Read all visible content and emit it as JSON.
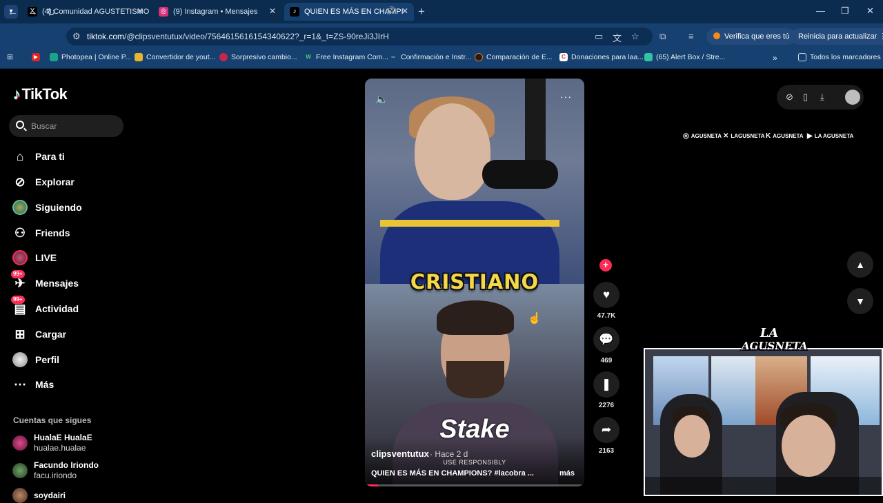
{
  "browser": {
    "tabs": [
      {
        "title": "(4) Comunidad AGUSTETISMO",
        "icon": "x-logo-icon"
      },
      {
        "title": "(9) Instagram • Mensajes",
        "icon": "instagram-icon"
      },
      {
        "title": "QUIEN ES MÁS EN CHAMPI",
        "icon": "tiktok-icon"
      }
    ],
    "url_domain": "tiktok.com",
    "url_path": "/@clipsventutux/video/7564615616154340622?_r=1&_t=ZS-90reJi3JIrH",
    "verify_label": "Verifica que eres tú",
    "update_label": "Reinicia para actualizar",
    "bookmarks": [
      {
        "label": "",
        "icon": "youtube-icon"
      },
      {
        "label": "Photopea | Online P...",
        "icon": "photopea-icon"
      },
      {
        "label": "Convertidor de yout...",
        "icon": "converter-icon"
      },
      {
        "label": "Sorpresivo cambio...",
        "icon": "news-icon"
      },
      {
        "label": "Free Instagram Com...",
        "icon": "w-icon"
      },
      {
        "label": "Confirmación e Instr...",
        "icon": "link-icon"
      },
      {
        "label": "Comparación de E...",
        "icon": "compare-icon"
      },
      {
        "label": "Donaciones para laa...",
        "icon": "c-icon"
      },
      {
        "label": "(65) Alert Box / Stre...",
        "icon": "streamlabs-icon"
      }
    ],
    "all_bookmarks_label": "Todos los marcadores"
  },
  "sidebar": {
    "brand": "TikTok",
    "search_placeholder": "Buscar",
    "items": [
      {
        "label": "Para ti",
        "icon": "home-icon"
      },
      {
        "label": "Explorar",
        "icon": "compass-icon"
      },
      {
        "label": "Siguiendo",
        "icon": "following-avatar-icon"
      },
      {
        "label": "Friends",
        "icon": "friends-icon"
      },
      {
        "label": "LIVE",
        "icon": "live-icon"
      },
      {
        "label": "Mensajes",
        "icon": "messages-icon",
        "badge": "99+"
      },
      {
        "label": "Actividad",
        "icon": "activity-icon",
        "badge": "99+"
      },
      {
        "label": "Cargar",
        "icon": "upload-icon"
      },
      {
        "label": "Perfil",
        "icon": "profile-avatar-icon"
      },
      {
        "label": "Más",
        "icon": "more-dots-icon"
      }
    ],
    "following_title": "Cuentas que sigues",
    "accounts": [
      {
        "name": "HualaE HualaE",
        "handle": "hualae.hualae"
      },
      {
        "name": "Facundo Iriondo",
        "handle": "facu.iriondo"
      },
      {
        "name": "soydairi",
        "handle": ""
      }
    ]
  },
  "video": {
    "caption_overlay": "CRISTIANO",
    "sponsor": "Stake",
    "sponsor_sub": "USE RESPONSIBLY",
    "username": "clipsventutux",
    "time": "· Hace 2 d",
    "description": "QUIEN ES MÁS EN CHAMPIONS? #lacobra ...",
    "more_label": "más",
    "progress": 0.06
  },
  "actions": {
    "likes": "47.7K",
    "comments": "469",
    "saves": "2276",
    "shares": "2163"
  },
  "overlay": {
    "brand_line1": "LA",
    "brand_line2": "AGUSNETA",
    "socials": [
      {
        "icon": "instagram-icon",
        "label": "AGUSNETA"
      },
      {
        "icon": "x-logo-icon",
        "label": "LAGUSNETA"
      },
      {
        "icon": "kick-icon",
        "label": "AGUSNETA"
      },
      {
        "icon": "youtube-icon",
        "label": "LA AGUSNETA"
      }
    ]
  },
  "colors": {
    "tiktok_red": "#fe2c55",
    "chrome_dark": "#0b2b4f",
    "chrome": "#16406f",
    "caption_yellow": "#f5d84a"
  }
}
